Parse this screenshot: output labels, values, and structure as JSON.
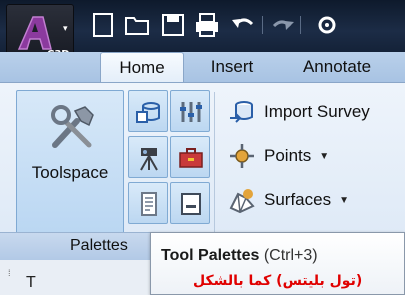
{
  "app": {
    "badge": "C3D",
    "accent_color": "#7a2e8e"
  },
  "quick_access": {
    "icons": [
      "new-icon",
      "open-icon",
      "save-icon",
      "print-icon",
      "undo-icon",
      "redo-icon",
      "settings-icon"
    ]
  },
  "tabs": [
    {
      "label": "Home",
      "active": true
    },
    {
      "label": "Insert",
      "active": false
    },
    {
      "label": "Annotate",
      "active": false
    }
  ],
  "ribbon": {
    "toolspace_label": "Toolspace",
    "small_buttons": [
      "prospector-icon",
      "settings-tools-icon",
      "survey-icon",
      "toolbox-icon",
      "pattern-icon",
      "command-line-icon"
    ],
    "commands": [
      {
        "label": "Import Survey",
        "icon": "import-survey-icon",
        "has_dropdown": false
      },
      {
        "label": "Points",
        "icon": "points-icon",
        "has_dropdown": true
      },
      {
        "label": "Surfaces",
        "icon": "surfaces-icon",
        "has_dropdown": true
      }
    ],
    "panel_title": "Palettes"
  },
  "tooltip": {
    "title": "Tool Palettes",
    "shortcut": "(Ctrl+3)",
    "note": "(تول بليتس) كما بالشكل"
  },
  "palette_strip": {
    "label": "T"
  }
}
